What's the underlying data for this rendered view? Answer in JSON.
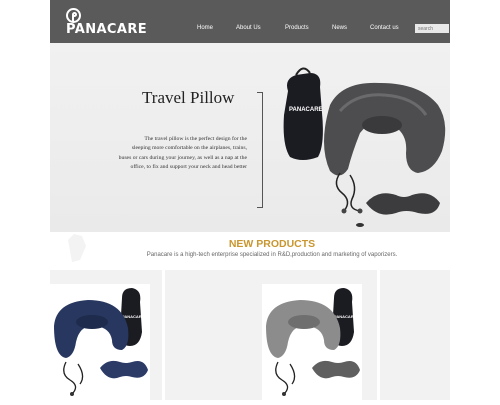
{
  "header": {
    "logo_text": "PANACARE",
    "nav": [
      "Home",
      "About Us",
      "Products",
      "News",
      "Contact us"
    ],
    "search_placeholder": "search"
  },
  "hero": {
    "title": "Travel Pillow",
    "description": [
      "The travel pillow is the perfect design for the",
      "sleeping more comfortable on the airplanes, trains,",
      "buses or cars during your journey, as well as a nap at the",
      "office, to fix and support your neck and head better"
    ],
    "bag_logo": "PANACARE"
  },
  "section": {
    "title": "NEW PRODUCTS",
    "subtitle": "Panacare is a high-tech enterprise specialized in R&D,production and marketing of vaporizers."
  },
  "products": [
    {
      "color_name": "navy",
      "pillow_color": "#27375f",
      "mask_color": "#2c3a66"
    },
    {
      "color_name": "grey",
      "pillow_color": "#8c8c8c",
      "mask_color": "#5f5f5f"
    }
  ],
  "colors": {
    "header_bg": "#5a5a5a",
    "accent": "#c9962f"
  }
}
